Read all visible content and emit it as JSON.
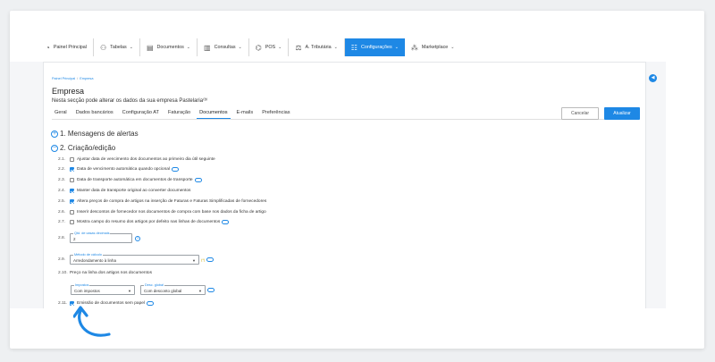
{
  "nav": {
    "items": [
      {
        "label": "Painel Principal",
        "icon": "dashboard-icon",
        "glyph": "◔",
        "chevron": ""
      },
      {
        "label": "Tabelas",
        "icon": "users-icon",
        "glyph": "⚇",
        "chevron": "⌄"
      },
      {
        "label": "Documentos",
        "icon": "document-icon",
        "glyph": "▤",
        "chevron": "⌄"
      },
      {
        "label": "Consultas",
        "icon": "building-icon",
        "glyph": "▥",
        "chevron": "⌄"
      },
      {
        "label": "POS",
        "icon": "pos-icon",
        "glyph": "⌬",
        "chevron": "⌄"
      },
      {
        "label": "A. Tributária",
        "icon": "tax-icon",
        "glyph": "⚖",
        "chevron": "⌄"
      },
      {
        "label": "Configurações",
        "icon": "settings-icon",
        "glyph": "☷",
        "chevron": "⌄"
      },
      {
        "label": "Marketplace",
        "icon": "marketplace-icon",
        "glyph": "⁂",
        "chevron": "⌄"
      }
    ],
    "active_index": 6
  },
  "breadcrumb": {
    "root": "Painel Principal",
    "sep": "/",
    "current": "Empresa"
  },
  "page": {
    "title": "Empresa",
    "subtitle": "Nesta secção pode alterar os dados da sua empresa Pastelaria⁽ᵇ⁾"
  },
  "tabs": [
    "Geral",
    "Dados bancários",
    "Configuração AT",
    "Faturação",
    "Documentos",
    "E-mails",
    "Preferências"
  ],
  "active_tab": 4,
  "actions": {
    "cancel": "Cancelar",
    "update": "Atualizar"
  },
  "sections": {
    "s1": {
      "toggle": "+",
      "label": "1. Mensagens de alertas"
    },
    "s2": {
      "toggle": "−",
      "label": "2. Criação/edição"
    }
  },
  "options": [
    {
      "num": "2.1.",
      "label": "Ajustar data de vencimento dos documentos ao primeiro dia útil seguinte",
      "checked": false,
      "info": false
    },
    {
      "num": "2.2.",
      "label": "Data de vencimento automática quando opcional",
      "checked": true,
      "info": true
    },
    {
      "num": "2.3.",
      "label": "Data de transporte automática em documentos de transporte",
      "checked": false,
      "info": true
    },
    {
      "num": "2.4.",
      "label": "Manter data de transporte original ao converter documentos",
      "checked": true,
      "info": false
    },
    {
      "num": "2.5.",
      "label": "Altera preços de compra de artigos na inserção de Faturas e Faturas Simplificadas de fornecedores",
      "checked": true,
      "info": false
    },
    {
      "num": "2.6.",
      "label": "Inserir descontos de fornecedor nos documentos de compra com base nos dados da ficha de artigo",
      "checked": false,
      "info": false
    },
    {
      "num": "2.7.",
      "label": "Mostra campo do resumo dos artigos por defeito nas linhas de documentos",
      "checked": false,
      "info": true
    }
  ],
  "decimals": {
    "num": "2.8.",
    "legend": "Qtd. de casas decimais",
    "value": "2",
    "help": "?"
  },
  "calc": {
    "num": "2.9.",
    "legend": "Método de cálculo",
    "value": "Arredondamento à linha",
    "note": "(*)"
  },
  "price": {
    "num": "2.10.",
    "label": "Preço na linha dos artigos nos documentos",
    "taxes": {
      "legend": "Impostos",
      "value": "Com impostos"
    },
    "discount": {
      "legend": "Desc. global",
      "value": "Com desconto global"
    }
  },
  "paperless": {
    "num": "2.11.",
    "label": "Emissão de documentos sem papel",
    "checked": true
  },
  "colors": {
    "accent": "#1e88e5"
  }
}
